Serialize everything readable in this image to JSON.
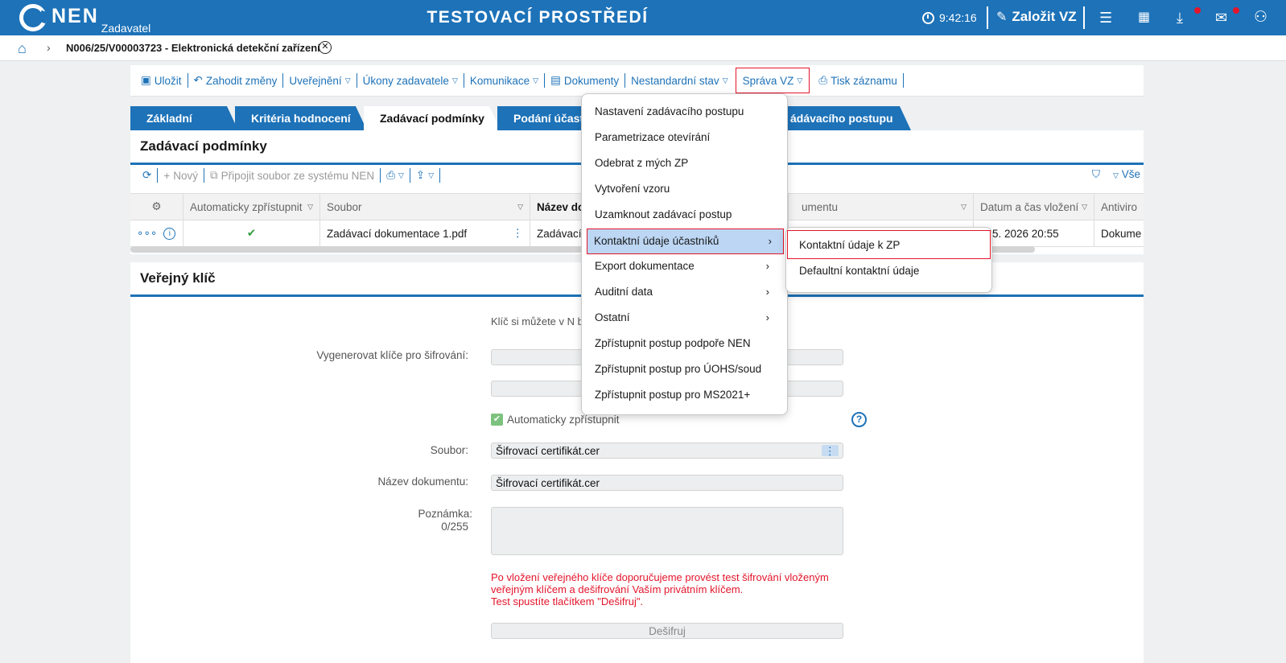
{
  "header": {
    "logo_text": "NEN",
    "role": "Zadavatel",
    "environment": "TESTOVACÍ PROSTŘEDÍ",
    "time": "9:42:16",
    "create_label": "Založit VZ",
    "notification_color": "#e3152b"
  },
  "breadcrumb": {
    "title": "N006/25/V00003723 - Elektronická detekční zařízení"
  },
  "toolbar": {
    "save": "Uložit",
    "discard": "Zahodit změny",
    "publish": "Uveřejnění",
    "acts": "Úkony zadavatele",
    "communication": "Komunikace",
    "documents": "Dokumenty",
    "nonstandard": "Nestandardní stav",
    "management": "Správa VZ",
    "print": "Tisk záznamu"
  },
  "tabs": {
    "basic": "Základní údaje",
    "criteria": "Kritéria hodnocení",
    "conditions": "Zadávací podmínky",
    "submission": "Podání účastn",
    "procedure": "ádávacího postupu"
  },
  "conditions": {
    "title": "Zadávací podmínky",
    "new": "Nový",
    "attach": "Připojit soubor ze systému NEN",
    "all": "Vše",
    "columns": {
      "auto": "Automaticky zpřístupnit",
      "file": "Soubor",
      "name": "Název dok",
      "doc": "umentu",
      "datetime": "Datum a čas vložení",
      "antivirus": "Antiviro"
    },
    "row": {
      "file": "Zadávací dokumentace 1.pdf",
      "name": "Zadávací",
      "datetime": "4. 5. 2026 20:55",
      "antivirus": "Dokume"
    }
  },
  "public_key": {
    "title": "Veřejný klíč",
    "hint": "Klíč si můžete v N                                          bo nahrát z vašeho zařízení.",
    "generate_label": "Vygenerovat klíče pro šifrování:",
    "auto_label": "Automaticky zpřístupnit",
    "file_label": "Soubor:",
    "file_value": "Šifrovací certifikát.cer",
    "docname_label": "Název dokumentu:",
    "docname_value": "Šifrovací certifikát.cer",
    "note_label": "Poznámka:",
    "note_counter": "0/255",
    "warning_1": "Po vložení veřejného klíče doporučujeme provést test šifrování vloženým veřejným klíčem a dešifrování Vaším privátním klíčem.",
    "warning_2": "Test spustíte tlačítkem \"Dešifruj\".",
    "decrypt": "Dešifruj"
  },
  "menu": {
    "items": [
      "Nastavení zadávacího postupu",
      "Parametrizace otevírání",
      "Odebrat z mých ZP",
      "Vytvoření vzoru",
      "Uzamknout zadávací postup",
      "Kontaktní údaje účastníků",
      "Export dokumentace",
      "Auditní data",
      "Ostatní",
      "Zpřístupnit postup podpoře NEN",
      "Zpřístupnit postup pro ÚOHS/soud",
      "Zpřístupnit postup pro MS2021+"
    ],
    "submenu": [
      "Kontaktní údaje k ZP",
      "Defaultní kontaktní údaje"
    ]
  }
}
